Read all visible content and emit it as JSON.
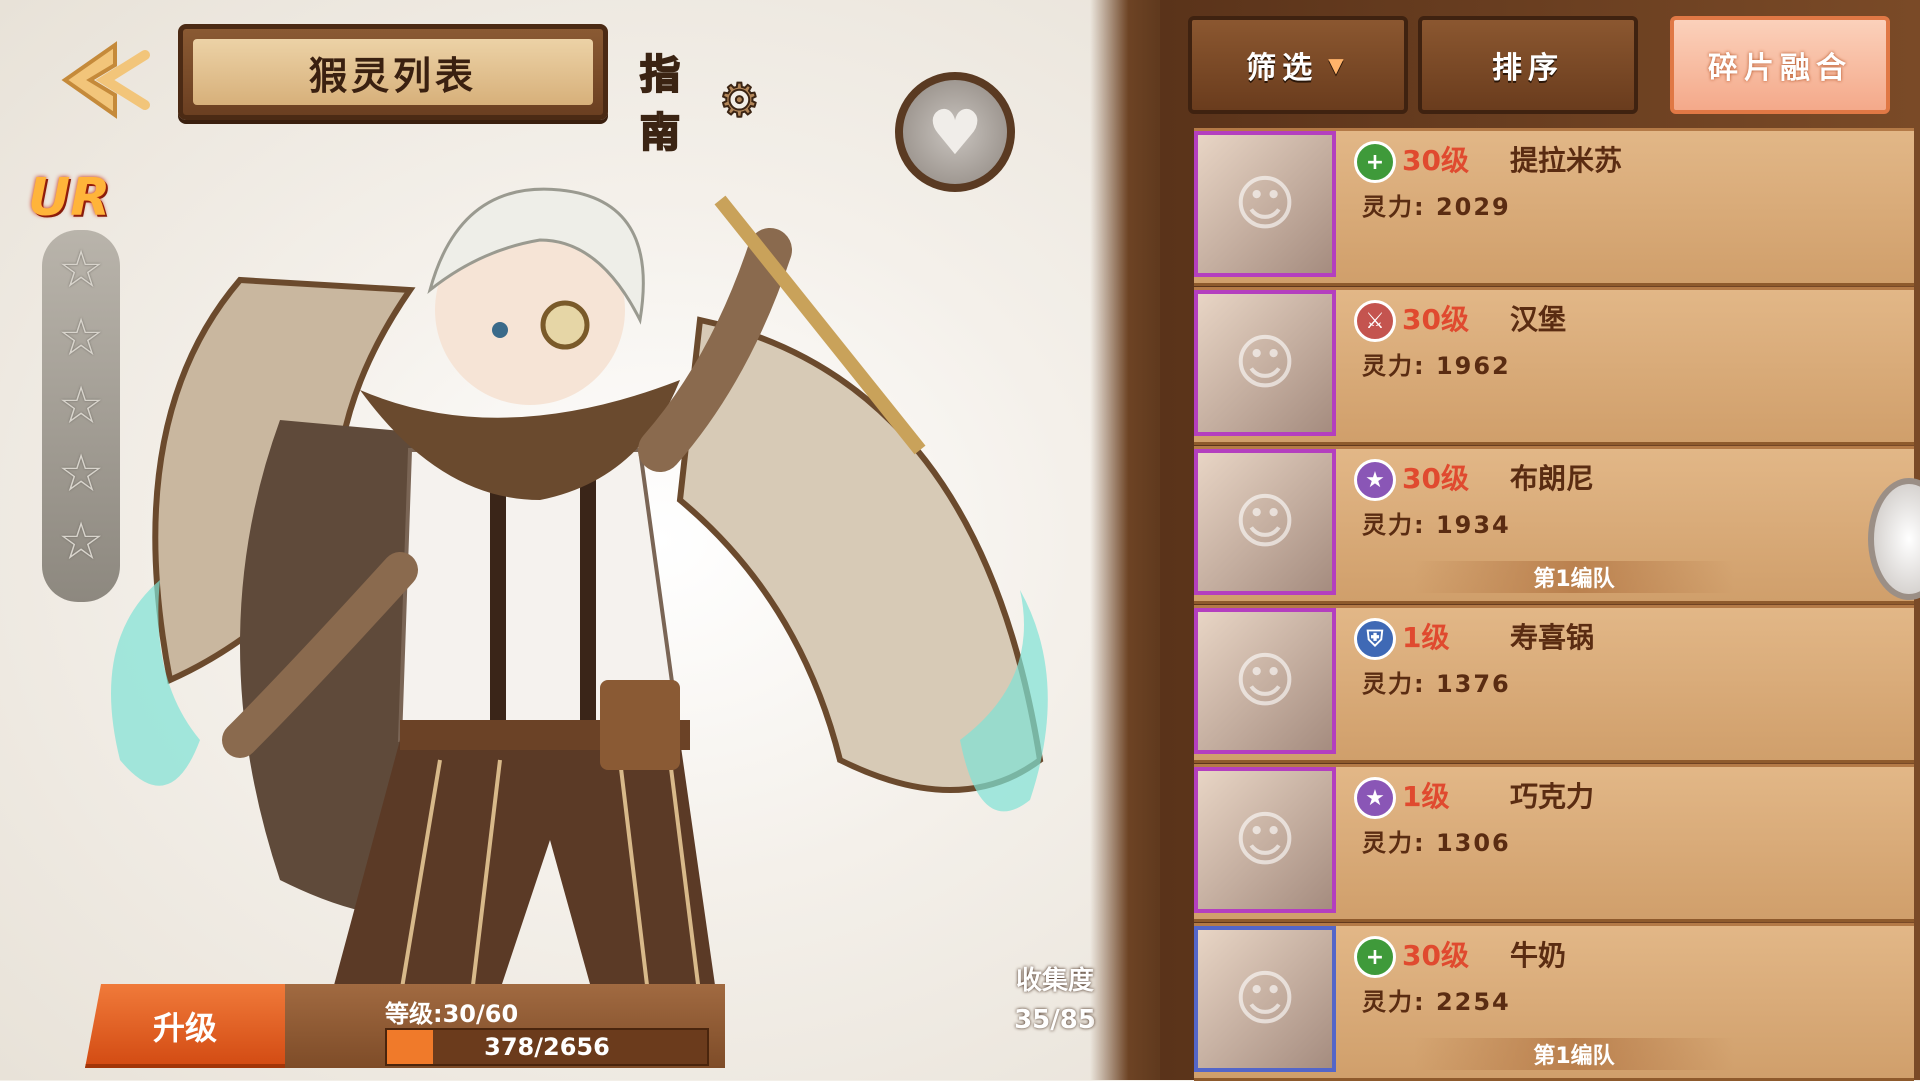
{
  "header": {
    "title": "猳灵列表",
    "guide_label": "指南"
  },
  "character": {
    "rarity": "UR",
    "stars": 5
  },
  "level_panel": {
    "upgrade_label": "升级",
    "level_text": "等级:30/60",
    "exp_current": 378,
    "exp_max": 2656,
    "exp_text": "378/2656"
  },
  "collection": {
    "label": "收集度",
    "value": "35/85"
  },
  "toolbar": {
    "filter_label": "筛选",
    "sort_label": "排序",
    "fuse_label": "碎片融合"
  },
  "cards": [
    {
      "level": "30级",
      "name": "提拉米苏",
      "power": "灵力: 2029",
      "icon": "plus-class-icon",
      "icon_color": "#3f9a3a",
      "team": ""
    },
    {
      "level": "30级",
      "name": "汉堡",
      "power": "灵力: 1962",
      "icon": "sword-class-icon",
      "icon_color": "#c4544f",
      "team": ""
    },
    {
      "level": "30级",
      "name": "布朗尼",
      "power": "灵力: 1934",
      "icon": "star-class-icon",
      "icon_color": "#8a56b6",
      "team": "第1编队"
    },
    {
      "level": "1级",
      "name": "寿喜锅",
      "power": "灵力: 1376",
      "icon": "shield-class-icon",
      "icon_color": "#3f69b5",
      "team": ""
    },
    {
      "level": "1级",
      "name": "巧克力",
      "power": "灵力: 1306",
      "icon": "star-class-icon",
      "icon_color": "#8a56b6",
      "team": ""
    },
    {
      "level": "30级",
      "name": "牛奶",
      "power": "灵力: 2254",
      "icon": "plus-class-icon",
      "icon_color": "#3f9a3a",
      "team": "第1编队"
    }
  ],
  "colors": {
    "accent_orange": "#f07a2a",
    "level_red": "#e04a2f",
    "name_brown": "#5a2c12"
  }
}
